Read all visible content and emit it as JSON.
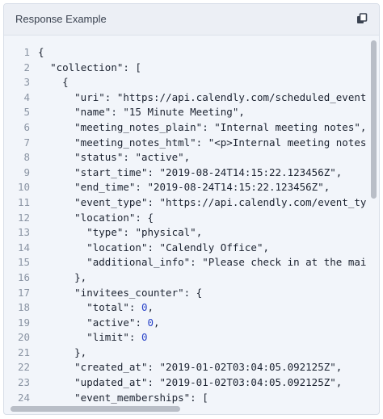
{
  "header": {
    "title": "Response Example",
    "copy_icon": "copy-icon"
  },
  "colors": {
    "background": "#f2f5fa",
    "header_bg": "#eceff5",
    "text": "#1b2230",
    "number": "#2b45c9",
    "line_number": "#8a94a3",
    "scrollbar": "#b9bec7"
  },
  "code": {
    "line_numbers": [
      "1",
      "2",
      "3",
      "4",
      "5",
      "6",
      "7",
      "8",
      "9",
      "10",
      "11",
      "12",
      "13",
      "14",
      "15",
      "16",
      "17",
      "18",
      "19",
      "20",
      "21",
      "22",
      "23",
      "24"
    ],
    "lines": [
      [
        {
          "t": "p",
          "s": "{"
        }
      ],
      [
        {
          "t": "p",
          "s": "  "
        },
        {
          "t": "k",
          "s": "\"collection\""
        },
        {
          "t": "p",
          "s": ": ["
        }
      ],
      [
        {
          "t": "p",
          "s": "    {"
        }
      ],
      [
        {
          "t": "p",
          "s": "      "
        },
        {
          "t": "k",
          "s": "\"uri\""
        },
        {
          "t": "p",
          "s": ": "
        },
        {
          "t": "v",
          "s": "\"https://api.calendly.com/scheduled_events/"
        }
      ],
      [
        {
          "t": "p",
          "s": "      "
        },
        {
          "t": "k",
          "s": "\"name\""
        },
        {
          "t": "p",
          "s": ": "
        },
        {
          "t": "v",
          "s": "\"15 Minute Meeting\""
        },
        {
          "t": "p",
          "s": ","
        }
      ],
      [
        {
          "t": "p",
          "s": "      "
        },
        {
          "t": "k",
          "s": "\"meeting_notes_plain\""
        },
        {
          "t": "p",
          "s": ": "
        },
        {
          "t": "v",
          "s": "\"Internal meeting notes\""
        },
        {
          "t": "p",
          "s": ","
        }
      ],
      [
        {
          "t": "p",
          "s": "      "
        },
        {
          "t": "k",
          "s": "\"meeting_notes_html\""
        },
        {
          "t": "p",
          "s": ": "
        },
        {
          "t": "v",
          "s": "\"<p>Internal meeting notes</"
        }
      ],
      [
        {
          "t": "p",
          "s": "      "
        },
        {
          "t": "k",
          "s": "\"status\""
        },
        {
          "t": "p",
          "s": ": "
        },
        {
          "t": "v",
          "s": "\"active\""
        },
        {
          "t": "p",
          "s": ","
        }
      ],
      [
        {
          "t": "p",
          "s": "      "
        },
        {
          "t": "k",
          "s": "\"start_time\""
        },
        {
          "t": "p",
          "s": ": "
        },
        {
          "t": "v",
          "s": "\"2019-08-24T14:15:22.123456Z\""
        },
        {
          "t": "p",
          "s": ","
        }
      ],
      [
        {
          "t": "p",
          "s": "      "
        },
        {
          "t": "k",
          "s": "\"end_time\""
        },
        {
          "t": "p",
          "s": ": "
        },
        {
          "t": "v",
          "s": "\"2019-08-24T14:15:22.123456Z\""
        },
        {
          "t": "p",
          "s": ","
        }
      ],
      [
        {
          "t": "p",
          "s": "      "
        },
        {
          "t": "k",
          "s": "\"event_type\""
        },
        {
          "t": "p",
          "s": ": "
        },
        {
          "t": "v",
          "s": "\"https://api.calendly.com/event_type"
        }
      ],
      [
        {
          "t": "p",
          "s": "      "
        },
        {
          "t": "k",
          "s": "\"location\""
        },
        {
          "t": "p",
          "s": ": {"
        }
      ],
      [
        {
          "t": "p",
          "s": "        "
        },
        {
          "t": "k",
          "s": "\"type\""
        },
        {
          "t": "p",
          "s": ": "
        },
        {
          "t": "v",
          "s": "\"physical\""
        },
        {
          "t": "p",
          "s": ","
        }
      ],
      [
        {
          "t": "p",
          "s": "        "
        },
        {
          "t": "k",
          "s": "\"location\""
        },
        {
          "t": "p",
          "s": ": "
        },
        {
          "t": "v",
          "s": "\"Calendly Office\""
        },
        {
          "t": "p",
          "s": ","
        }
      ],
      [
        {
          "t": "p",
          "s": "        "
        },
        {
          "t": "k",
          "s": "\"additional_info\""
        },
        {
          "t": "p",
          "s": ": "
        },
        {
          "t": "v",
          "s": "\"Please check in at the main"
        }
      ],
      [
        {
          "t": "p",
          "s": "      },"
        }
      ],
      [
        {
          "t": "p",
          "s": "      "
        },
        {
          "t": "k",
          "s": "\"invitees_counter\""
        },
        {
          "t": "p",
          "s": ": {"
        }
      ],
      [
        {
          "t": "p",
          "s": "        "
        },
        {
          "t": "k",
          "s": "\"total\""
        },
        {
          "t": "p",
          "s": ": "
        },
        {
          "t": "num",
          "s": "0"
        },
        {
          "t": "p",
          "s": ","
        }
      ],
      [
        {
          "t": "p",
          "s": "        "
        },
        {
          "t": "k",
          "s": "\"active\""
        },
        {
          "t": "p",
          "s": ": "
        },
        {
          "t": "num",
          "s": "0"
        },
        {
          "t": "p",
          "s": ","
        }
      ],
      [
        {
          "t": "p",
          "s": "        "
        },
        {
          "t": "k",
          "s": "\"limit\""
        },
        {
          "t": "p",
          "s": ": "
        },
        {
          "t": "num",
          "s": "0"
        }
      ],
      [
        {
          "t": "p",
          "s": "      },"
        }
      ],
      [
        {
          "t": "p",
          "s": "      "
        },
        {
          "t": "k",
          "s": "\"created_at\""
        },
        {
          "t": "p",
          "s": ": "
        },
        {
          "t": "v",
          "s": "\"2019-01-02T03:04:05.092125Z\""
        },
        {
          "t": "p",
          "s": ","
        }
      ],
      [
        {
          "t": "p",
          "s": "      "
        },
        {
          "t": "k",
          "s": "\"updated_at\""
        },
        {
          "t": "p",
          "s": ": "
        },
        {
          "t": "v",
          "s": "\"2019-01-02T03:04:05.092125Z\""
        },
        {
          "t": "p",
          "s": ","
        }
      ],
      [
        {
          "t": "p",
          "s": "      "
        },
        {
          "t": "k",
          "s": "\"event_memberships\""
        },
        {
          "t": "p",
          "s": ": ["
        }
      ]
    ]
  }
}
